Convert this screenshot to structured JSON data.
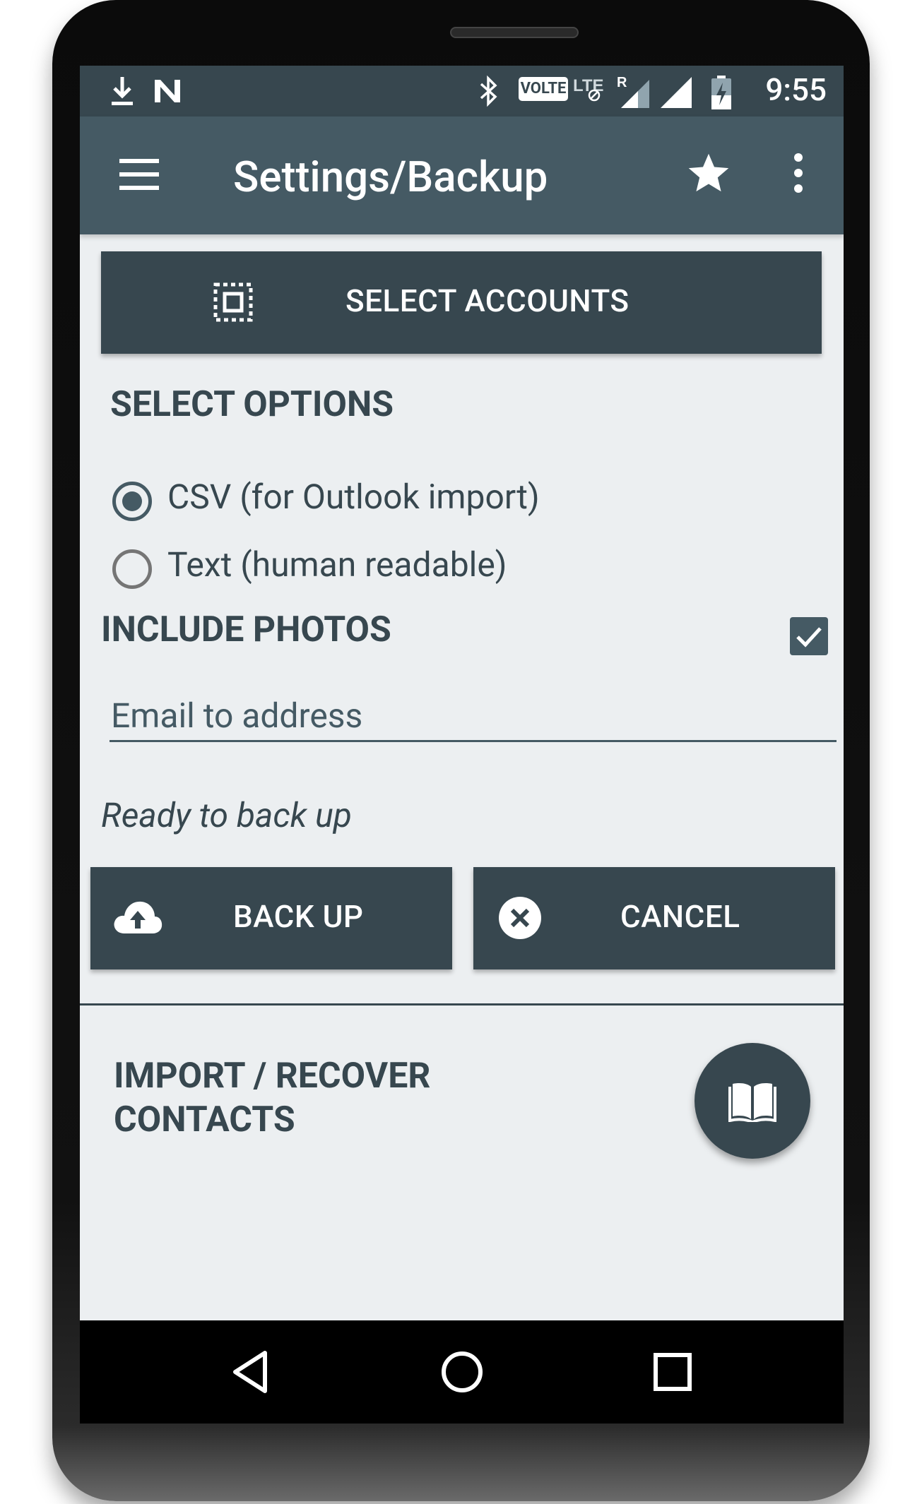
{
  "status_bar": {
    "time": "9:55",
    "volte": "VOLTE",
    "icons": [
      "download-icon",
      "n-notification-icon",
      "bluetooth-icon",
      "volte-badge",
      "lte-icon",
      "roaming-signal-icon",
      "signal-icon",
      "battery-charging-icon"
    ]
  },
  "app_bar": {
    "title": "Settings/Backup",
    "menu_icon": "hamburger-menu-icon",
    "favorite_icon": "star-icon",
    "overflow_icon": "more-vert-icon"
  },
  "select_accounts": {
    "label": "SELECT ACCOUNTS",
    "icon": "select-all-icon"
  },
  "options": {
    "heading": "SELECT OPTIONS",
    "formats": [
      {
        "label": "CSV (for Outlook import)",
        "selected": true
      },
      {
        "label": "Text (human readable)",
        "selected": false
      }
    ],
    "include_photos_label": "INCLUDE PHOTOS",
    "include_photos_checked": true
  },
  "email": {
    "placeholder": "Email to address",
    "value": ""
  },
  "status": {
    "text": "Ready to back up"
  },
  "actions": {
    "backup_label": "BACK UP",
    "backup_icon": "cloud-upload-icon",
    "cancel_label": "CANCEL",
    "cancel_icon": "cancel-circle-icon"
  },
  "import_section": {
    "heading_line1": "IMPORT / RECOVER",
    "heading_line2": "CONTACTS",
    "fab_icon": "book-icon"
  },
  "nav_bar": {
    "icons": [
      "back-icon",
      "home-icon",
      "recents-icon"
    ]
  },
  "colors": {
    "status_bar": "#37474f",
    "app_bar": "#455a64",
    "button": "#37474f",
    "background": "#eceff1"
  }
}
